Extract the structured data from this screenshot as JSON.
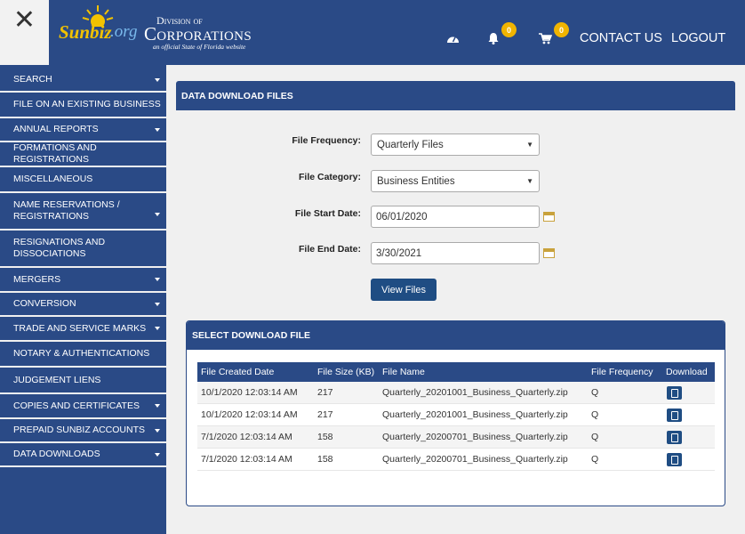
{
  "header": {
    "logo": {
      "sunbiz": "Sunbiz",
      "org": ".org",
      "division": "Division of",
      "corporations": "Corporations",
      "tagline": "an official State of Florida website"
    },
    "dashboard_icon": "dashboard-gauge-icon",
    "notifications_count": "0",
    "cart_count": "0",
    "contact_us": "CONTACT US",
    "logout": "LOGOUT"
  },
  "sidebar": {
    "items": [
      {
        "label": "SEARCH",
        "has_caret": true
      },
      {
        "label": "FILE ON AN EXISTING BUSINESS",
        "has_caret": false
      },
      {
        "label": "ANNUAL REPORTS",
        "has_caret": true
      },
      {
        "label": "FORMATIONS AND REGISTRATIONS",
        "has_caret": false
      },
      {
        "label": "MISCELLANEOUS",
        "has_caret": false
      },
      {
        "label": "NAME RESERVATIONS / REGISTRATIONS",
        "has_caret": true
      },
      {
        "label": "RESIGNATIONS AND DISSOCIATIONS",
        "has_caret": false
      },
      {
        "label": "MERGERS",
        "has_caret": true
      },
      {
        "label": "CONVERSION",
        "has_caret": true
      },
      {
        "label": "TRADE AND SERVICE MARKS",
        "has_caret": true
      },
      {
        "label": "NOTARY & AUTHENTICATIONS",
        "has_caret": false
      },
      {
        "label": "JUDGEMENT LIENS",
        "has_caret": false
      },
      {
        "label": "COPIES AND CERTIFICATES",
        "has_caret": true
      },
      {
        "label": "PREPAID SUNBIZ ACCOUNTS",
        "has_caret": true
      },
      {
        "label": "DATA DOWNLOADS",
        "has_caret": true
      }
    ]
  },
  "main": {
    "title": "DATA DOWNLOAD FILES",
    "form": {
      "frequency_label": "File Frequency:",
      "frequency_value": "Quarterly Files",
      "category_label": "File Category:",
      "category_value": "Business Entities",
      "start_label": "File Start Date:",
      "start_value": "06/01/2020",
      "end_label": "File End Date:",
      "end_value": "3/30/2021",
      "view_button": "View Files"
    },
    "downloads": {
      "title": "SELECT DOWNLOAD FILE",
      "columns": [
        "File Created Date",
        "File Size (KB)",
        "File Name",
        "File Frequency",
        "Download"
      ],
      "rows": [
        [
          "10/1/2020 12:03:14 AM",
          "217",
          "Quarterly_20201001_Business_Quarterly.zip",
          "Q"
        ],
        [
          "10/1/2020 12:03:14 AM",
          "217",
          "Quarterly_20201001_Business_Quarterly.zip",
          "Q"
        ],
        [
          "7/1/2020 12:03:14 AM",
          "158",
          "Quarterly_20200701_Business_Quarterly.zip",
          "Q"
        ],
        [
          "7/1/2020 12:03:14 AM",
          "158",
          "Quarterly_20200701_Business_Quarterly.zip",
          "Q"
        ]
      ]
    }
  },
  "colors": {
    "navy": "#2a4a86",
    "button": "#1f4d83",
    "badge": "#f0b400"
  }
}
